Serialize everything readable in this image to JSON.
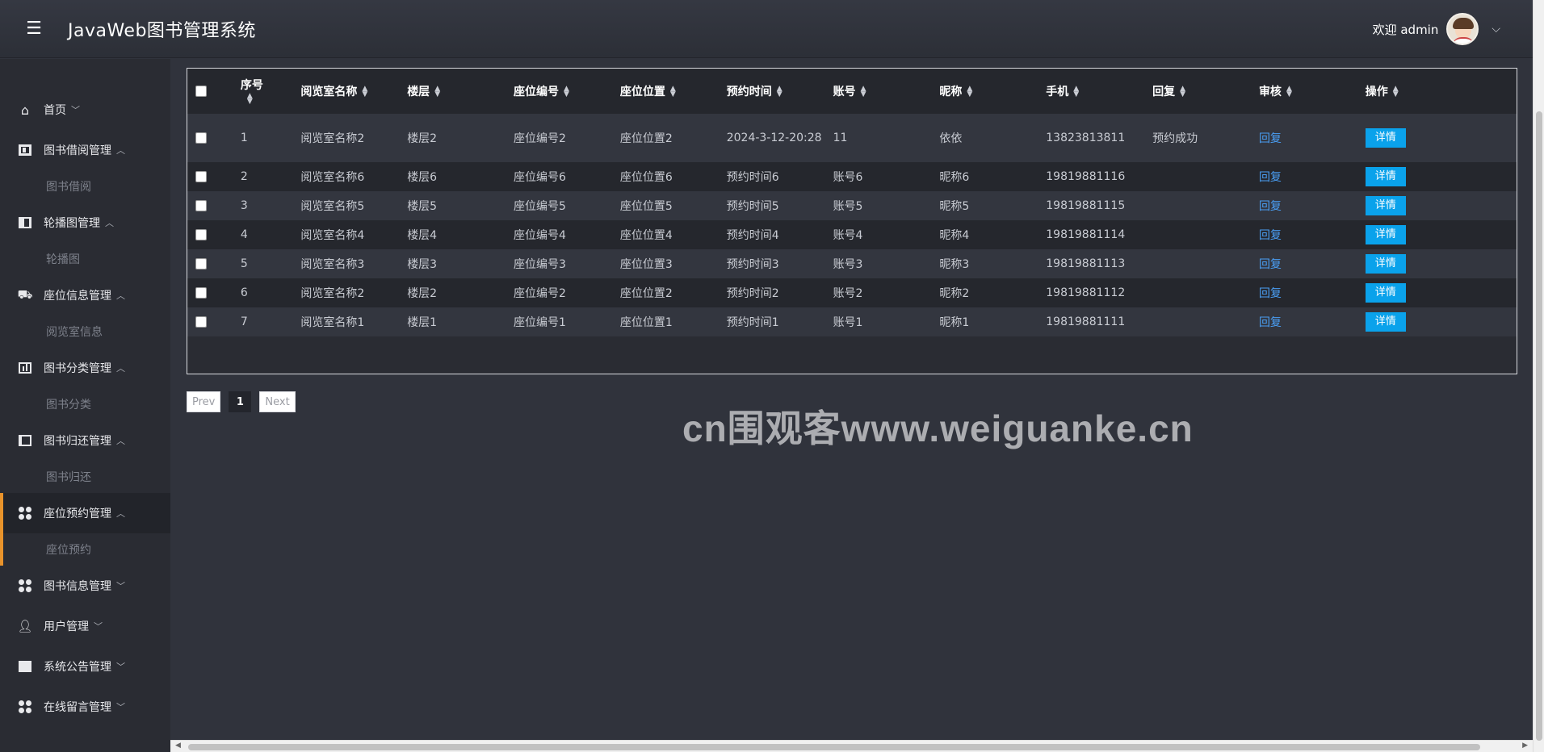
{
  "header": {
    "title": "JavaWeb图书管理系统",
    "welcome": "欢迎 admin"
  },
  "sidebar": {
    "items": [
      {
        "label": "首页",
        "icon": "home-icon",
        "arrow": "down"
      },
      {
        "label": "图书借阅管理",
        "icon": "table-icon",
        "arrow": "up",
        "sub": "图书借阅"
      },
      {
        "label": "轮播图管理",
        "icon": "columns-icon",
        "arrow": "up",
        "sub": "轮播图"
      },
      {
        "label": "座位信息管理",
        "icon": "seat-icon",
        "arrow": "up",
        "sub": "阅览室信息"
      },
      {
        "label": "图书分类管理",
        "icon": "chart-icon",
        "arrow": "up",
        "sub": "图书分类"
      },
      {
        "label": "图书归还管理",
        "icon": "book-icon",
        "arrow": "up",
        "sub": "图书归还"
      },
      {
        "label": "座位预约管理",
        "icon": "grid-icon",
        "arrow": "up",
        "sub": "座位预约",
        "active": true
      },
      {
        "label": "图书信息管理",
        "icon": "grid-icon",
        "arrow": "down"
      },
      {
        "label": "用户管理",
        "icon": "user-icon",
        "arrow": "down"
      },
      {
        "label": "系统公告管理",
        "icon": "server-icon",
        "arrow": "down"
      },
      {
        "label": "在线留言管理",
        "icon": "grid-icon",
        "arrow": "down"
      }
    ]
  },
  "table": {
    "columns": [
      "序号",
      "阅览室名称",
      "楼层",
      "座位编号",
      "座位位置",
      "预约时间",
      "账号",
      "昵称",
      "手机",
      "回复",
      "审核",
      "操作"
    ],
    "rows": [
      [
        "1",
        "阅览室名称2",
        "楼层2",
        "座位编号2",
        "座位位置2",
        "2024-3-12-20:28",
        "11",
        "依依",
        "13823813811",
        "预约成功",
        "回复",
        "详情"
      ],
      [
        "2",
        "阅览室名称6",
        "楼层6",
        "座位编号6",
        "座位位置6",
        "预约时间6",
        "账号6",
        "昵称6",
        "19819881116",
        "",
        "回复",
        "详情"
      ],
      [
        "3",
        "阅览室名称5",
        "楼层5",
        "座位编号5",
        "座位位置5",
        "预约时间5",
        "账号5",
        "昵称5",
        "19819881115",
        "",
        "回复",
        "详情"
      ],
      [
        "4",
        "阅览室名称4",
        "楼层4",
        "座位编号4",
        "座位位置4",
        "预约时间4",
        "账号4",
        "昵称4",
        "19819881114",
        "",
        "回复",
        "详情"
      ],
      [
        "5",
        "阅览室名称3",
        "楼层3",
        "座位编号3",
        "座位位置3",
        "预约时间3",
        "账号3",
        "昵称3",
        "19819881113",
        "",
        "回复",
        "详情"
      ],
      [
        "6",
        "阅览室名称2",
        "楼层2",
        "座位编号2",
        "座位位置2",
        "预约时间2",
        "账号2",
        "昵称2",
        "19819881112",
        "",
        "回复",
        "详情"
      ],
      [
        "7",
        "阅览室名称1",
        "楼层1",
        "座位编号1",
        "座位位置1",
        "预约时间1",
        "账号1",
        "昵称1",
        "19819881111",
        "",
        "回复",
        "详情"
      ]
    ]
  },
  "pagination": {
    "prev": "Prev",
    "current": "1",
    "next": "Next"
  },
  "watermark": "cn围观客www.weiguanke.cn",
  "colors": {
    "accent": "#e8932b",
    "button": "#0aa2eb",
    "link": "#4a9ff5"
  }
}
